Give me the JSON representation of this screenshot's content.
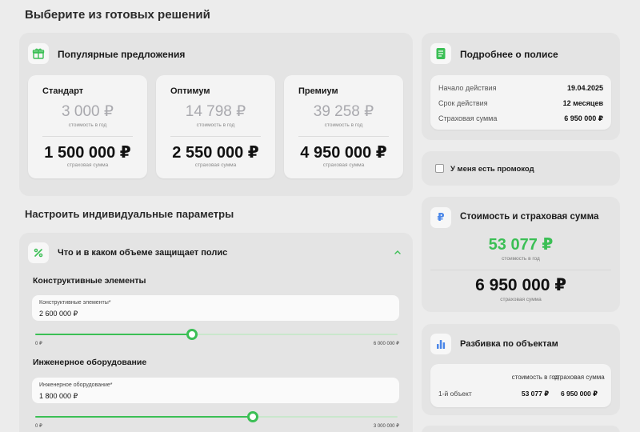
{
  "ready": {
    "title": "Выберите из готовых решений",
    "popular_title": "Популярные предложения",
    "plans": [
      {
        "name": "Стандарт",
        "price": "3 000 ₽",
        "price_sub": "стоимость в год",
        "sum": "1 500 000 ₽",
        "sum_sub": "страховая сумма"
      },
      {
        "name": "Оптимум",
        "price": "14 798 ₽",
        "price_sub": "стоимость в год",
        "sum": "2 550 000 ₽",
        "sum_sub": "страховая сумма"
      },
      {
        "name": "Премиум",
        "price": "39 258 ₽",
        "price_sub": "стоимость в год",
        "sum": "4 950 000 ₽",
        "sum_sub": "страховая сумма"
      }
    ]
  },
  "custom": {
    "title": "Настроить индивидуальные параметры",
    "coverage_title": "Что и в каком объеме защищает полис",
    "groups": [
      {
        "heading": "Конструктивные элементы",
        "field_label": "Конструктивные элементы*",
        "value": "2 600 000 ₽",
        "min": "0 ₽",
        "max": "6 000 000 ₽",
        "fraction": 0.433
      },
      {
        "heading": "Инженерное оборудование",
        "field_label": "Инженерное оборудование*",
        "value": "1 800 000 ₽",
        "min": "0 ₽",
        "max": "3 000 000 ₽",
        "fraction": 0.6
      }
    ]
  },
  "policy": {
    "title": "Подробнее о полисе",
    "rows": [
      {
        "label": "Начало действия",
        "value": "19.04.2025"
      },
      {
        "label": "Срок действия",
        "value": "12 месяцев"
      },
      {
        "label": "Страховая сумма",
        "value": "6 950 000 ₽"
      }
    ]
  },
  "promo": {
    "label": "У меня есть промокод",
    "checked": false
  },
  "cost": {
    "title": "Стоимость и страховая сумма",
    "price": "53 077 ₽",
    "price_sub": "стоимость в год",
    "sum": "6 950 000 ₽",
    "sum_sub": "страховая сумма"
  },
  "breakdown": {
    "title": "Разбивка по объектам",
    "col1": "стоимость в год",
    "col2": "страховая сумма",
    "rows": [
      {
        "name": "1-й объект",
        "price": "53 077 ₽",
        "sum": "6 950 000 ₽"
      }
    ]
  },
  "colors": {
    "accent": "#3bbf55",
    "muted_price": "#a9a9ae",
    "ruble_icon": "#4a86e8",
    "chart_icon": "#4a86e8"
  }
}
